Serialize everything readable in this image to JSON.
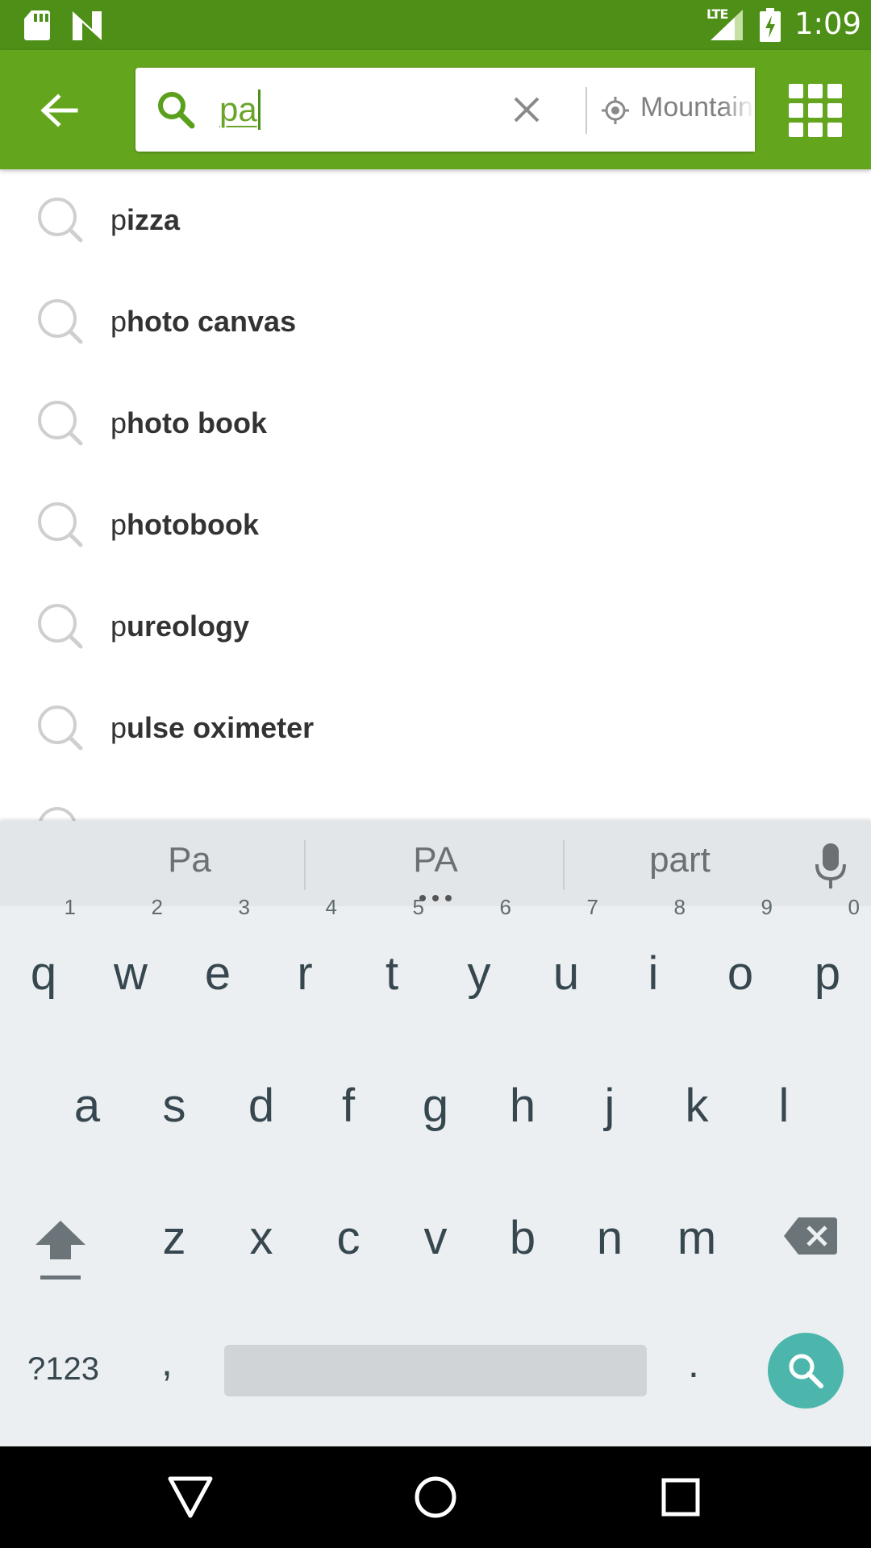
{
  "status_bar": {
    "time": "1:09",
    "network": "LTE",
    "icons": [
      "sd-card-icon",
      "n-notification-icon",
      "lte-signal-icon",
      "battery-charging-icon"
    ]
  },
  "toolbar": {
    "back_icon": "arrow-back-icon",
    "search": {
      "query": "pa",
      "icon": "search-icon",
      "clear_icon": "close-icon"
    },
    "location": {
      "text": "Mountain",
      "icon": "location-target-icon"
    },
    "menu_icon": "grid-menu-icon",
    "colors": {
      "toolbar": "#64a51e",
      "status_bar": "#4e8f17",
      "accent": "#6aa52a"
    }
  },
  "suggestions": [
    {
      "prefix": "p",
      "rest": "izza"
    },
    {
      "prefix": "p",
      "rest": "hoto canvas"
    },
    {
      "prefix": "p",
      "rest": "hoto book"
    },
    {
      "prefix": "p",
      "rest": "hotobook"
    },
    {
      "prefix": "p",
      "rest": "ureology"
    },
    {
      "prefix": "p",
      "rest": "ulse oximeter"
    }
  ],
  "keyboard": {
    "word_suggestions": [
      "Pa",
      "PA",
      "part"
    ],
    "row1": [
      {
        "key": "q",
        "num": "1"
      },
      {
        "key": "w",
        "num": "2"
      },
      {
        "key": "e",
        "num": "3"
      },
      {
        "key": "r",
        "num": "4"
      },
      {
        "key": "t",
        "num": "5"
      },
      {
        "key": "y",
        "num": "6"
      },
      {
        "key": "u",
        "num": "7"
      },
      {
        "key": "i",
        "num": "8"
      },
      {
        "key": "o",
        "num": "9"
      },
      {
        "key": "p",
        "num": "0"
      }
    ],
    "row2": [
      "a",
      "s",
      "d",
      "f",
      "g",
      "h",
      "j",
      "k",
      "l"
    ],
    "row3": [
      "z",
      "x",
      "c",
      "v",
      "b",
      "n",
      "m"
    ],
    "symbols_label": "?123",
    "comma": ",",
    "period": ".",
    "action_icon": "search-icon",
    "action_color": "#4db6ac"
  },
  "navbar": {
    "icons": [
      "back-triangle-icon",
      "home-circle-icon",
      "recents-square-icon"
    ]
  }
}
